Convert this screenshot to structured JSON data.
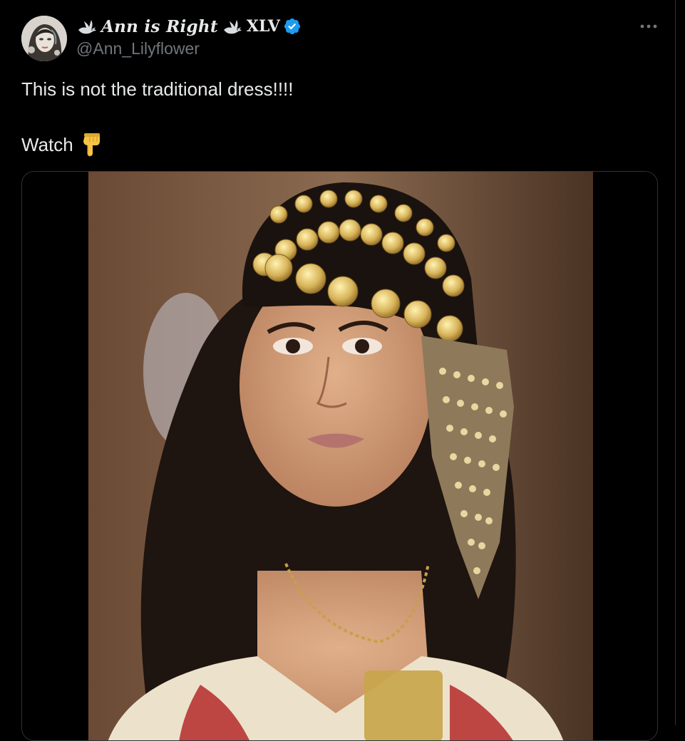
{
  "tweet": {
    "author": {
      "display_name": "Ann is Right",
      "name_suffix": "XLV",
      "handle": "@Ann_Lilyflower",
      "verified": true,
      "avatar_icon": "avatar-portrait",
      "name_emoji": "dove-icon"
    },
    "text_lines": [
      "This is not the traditional dress!!!!",
      "Watch"
    ],
    "text_emoji": "backhand-index-pointing-down",
    "more_icon": "ellipsis-icon",
    "media": {
      "type": "video"
    }
  },
  "colors": {
    "background": "#000000",
    "text": "#e7e9ea",
    "secondary_text": "#71767b",
    "verified_badge": "#1d9bf0",
    "border": "#2f3336"
  }
}
